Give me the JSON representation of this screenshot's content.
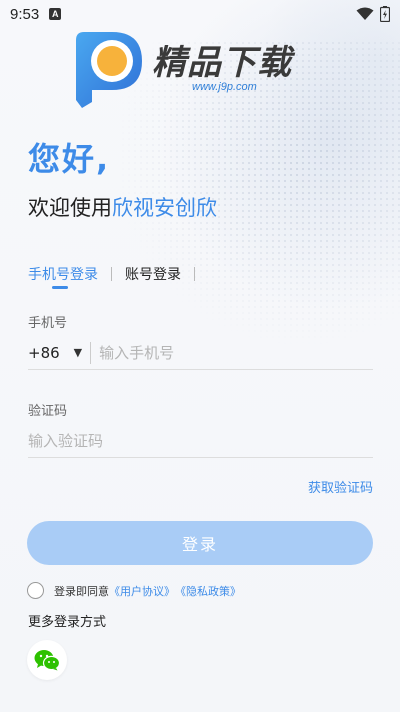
{
  "status_bar": {
    "time": "9:53",
    "notification_glyph": "A"
  },
  "logo": {
    "title": "精品下载",
    "url": "www.j9p.com"
  },
  "greeting": {
    "hello": "您好,",
    "welcome_prefix": "欢迎使用",
    "app_name": "欣视安创欣"
  },
  "tabs": [
    {
      "label": "手机号登录",
      "active": true
    },
    {
      "label": "账号登录",
      "active": false
    }
  ],
  "phone": {
    "label": "手机号",
    "country_code": "+86",
    "placeholder": "输入手机号"
  },
  "code": {
    "label": "验证码",
    "placeholder": "输入验证码",
    "get_code": "获取验证码"
  },
  "login_button": "登录",
  "agreement": {
    "text": "登录即同意",
    "user_agreement": "《用户协议》",
    "privacy_policy": "《隐私政策》"
  },
  "more_login": "更多登录方式",
  "colors": {
    "accent": "#3d8be8",
    "button_disabled": "#a9ccf6",
    "wechat": "#2dc100"
  },
  "icons": [
    "wifi-icon",
    "battery-icon",
    "chevron-down-icon",
    "wechat-icon"
  ]
}
